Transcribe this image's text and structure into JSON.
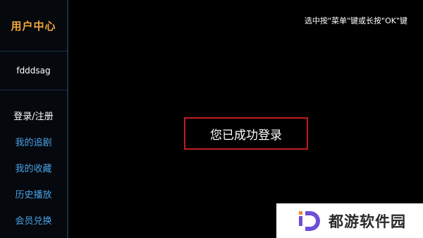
{
  "sidebar": {
    "title": "用户中心",
    "username": "fdddsag",
    "items": [
      {
        "label": "登录/注册",
        "active": true
      },
      {
        "label": "我的追剧",
        "active": false
      },
      {
        "label": "我的收藏",
        "active": false
      },
      {
        "label": "历史播放",
        "active": false
      },
      {
        "label": "会员兑换",
        "active": false
      }
    ]
  },
  "hint": "选中按\"菜单\"键或长按\"OK\"键",
  "main": {
    "message": "您已成功登录"
  },
  "watermark": {
    "text": "都游软件园",
    "logo": "d-logo-icon"
  },
  "colors": {
    "accent_title": "#f0a73a",
    "menu_link": "#4aa3e8",
    "message_border": "#c01d1d",
    "background": "#000000"
  }
}
